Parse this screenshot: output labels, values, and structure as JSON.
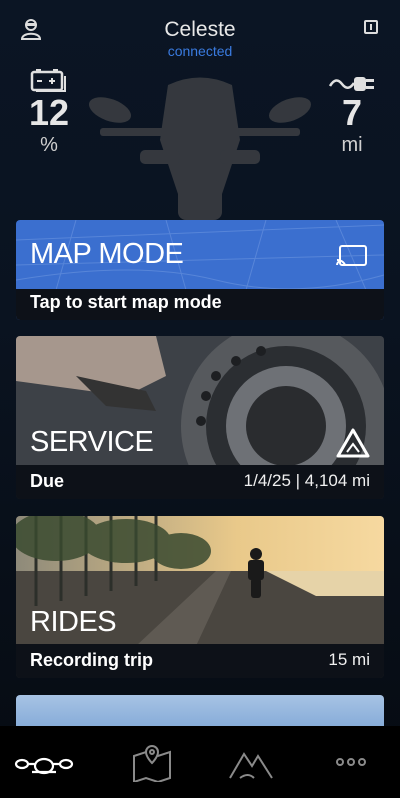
{
  "header": {
    "device_name": "Celeste",
    "status": "connected",
    "battery": {
      "value": "12",
      "unit": "%"
    },
    "range": {
      "value": "7",
      "unit": "mi"
    }
  },
  "cards": {
    "map": {
      "title": "MAP MODE",
      "subtitle": "Tap to start map mode"
    },
    "service": {
      "title": "SERVICE",
      "subtitle": "Due",
      "meta": "1/4/25 | 4,104 mi"
    },
    "rides": {
      "title": "RIDES",
      "subtitle": "Recording trip",
      "meta": "15 mi"
    }
  },
  "icons": {
    "profile": "profile-icon",
    "info": "info-icon",
    "battery": "battery-icon",
    "charging": "charging-plug-icon",
    "cast": "cast-icon",
    "warning": "warning-triangle-icon",
    "nav": [
      "motorcycle-icon",
      "map-pin-icon",
      "mountains-icon",
      "more-icon"
    ]
  },
  "colors": {
    "accent": "#3a7be0",
    "map_card": "#3b6fcf",
    "background": "#0b1524"
  }
}
